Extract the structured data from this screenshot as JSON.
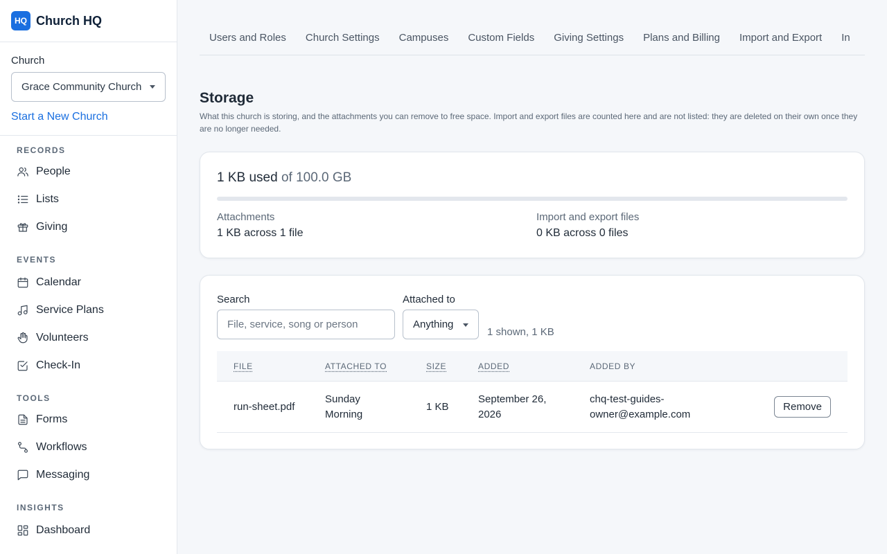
{
  "brand": {
    "logo_text": "HQ",
    "name": "Church HQ"
  },
  "church": {
    "label": "Church",
    "selected": "Grace Community Church",
    "new_link": "Start a New Church"
  },
  "sidebar": {
    "sections": [
      {
        "heading": "RECORDS",
        "items": [
          {
            "label": "People",
            "icon": "people-icon"
          },
          {
            "label": "Lists",
            "icon": "list-icon"
          },
          {
            "label": "Giving",
            "icon": "gift-icon"
          }
        ]
      },
      {
        "heading": "EVENTS",
        "items": [
          {
            "label": "Calendar",
            "icon": "calendar-icon"
          },
          {
            "label": "Service Plans",
            "icon": "music-note-icon"
          },
          {
            "label": "Volunteers",
            "icon": "hand-icon"
          },
          {
            "label": "Check-In",
            "icon": "checkbox-icon"
          }
        ]
      },
      {
        "heading": "TOOLS",
        "items": [
          {
            "label": "Forms",
            "icon": "document-icon"
          },
          {
            "label": "Workflows",
            "icon": "workflow-icon"
          },
          {
            "label": "Messaging",
            "icon": "chat-icon"
          }
        ]
      },
      {
        "heading": "INSIGHTS",
        "items": [
          {
            "label": "Dashboard",
            "icon": "dashboard-icon"
          }
        ]
      }
    ]
  },
  "tabs": [
    "Users and Roles",
    "Church Settings",
    "Campuses",
    "Custom Fields",
    "Giving Settings",
    "Plans and Billing",
    "Import and Export",
    "In"
  ],
  "page": {
    "title": "Storage",
    "description": "What this church is storing, and the attachments you can remove to free space. Import and export files are counted here and are not listed: they are deleted on their own once they are no longer needed."
  },
  "usage": {
    "used": "1 KB used",
    "of_total": "of 100.0 GB",
    "used_fraction": 1e-08,
    "attachments_label": "Attachments",
    "attachments_value": "1 KB across 1 file",
    "import_label": "Import and export files",
    "import_value": "0 KB across 0 files"
  },
  "filters": {
    "search_label": "Search",
    "search_placeholder": "File, service, song or person",
    "attached_label": "Attached to",
    "attached_value": "Anything",
    "summary": "1 shown, 1 KB"
  },
  "table": {
    "headers": [
      "FILE",
      "ATTACHED TO",
      "SIZE",
      "ADDED",
      "ADDED BY"
    ],
    "rows": [
      {
        "file": "run-sheet.pdf",
        "attached_to": "Sunday Morning",
        "size": "1 KB",
        "added": "September 26, 2026",
        "added_by": "chq-test-guides-owner@example.com",
        "action": "Remove"
      }
    ]
  },
  "colors": {
    "accent": "#1a6fe0",
    "background": "#f5f7fa"
  }
}
